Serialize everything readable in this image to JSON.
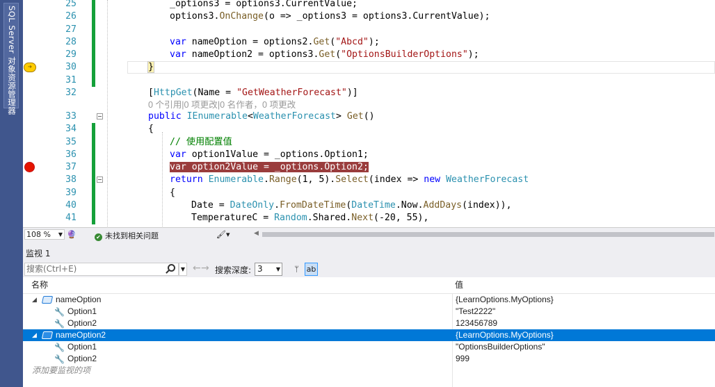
{
  "sidebar": {
    "tab_label": "SQL Server 对象资源管理器"
  },
  "editor": {
    "lines": [
      {
        "num": "25",
        "tokens": [
          [
            "_options3 = options3.",
            "p"
          ],
          [
            "CurrentValue",
            "p"
          ],
          [
            ";",
            "p"
          ]
        ]
      },
      {
        "num": "26",
        "tokens": [
          [
            "options3.",
            "p"
          ],
          [
            "OnChange",
            "mt"
          ],
          [
            "(o => _options3 = options3.CurrentValue);",
            "p"
          ]
        ]
      },
      {
        "num": "27",
        "tokens": []
      },
      {
        "num": "28",
        "tokens": [
          [
            "var",
            "kw"
          ],
          [
            " nameOption = options2.",
            "p"
          ],
          [
            "Get",
            "mt"
          ],
          [
            "(",
            "p"
          ],
          [
            "\"Abcd\"",
            "st"
          ],
          [
            ");",
            "p"
          ]
        ]
      },
      {
        "num": "29",
        "tokens": [
          [
            "var",
            "kw"
          ],
          [
            " nameOption2 = options3.",
            "p"
          ],
          [
            "Get",
            "mt"
          ],
          [
            "(",
            "p"
          ],
          [
            "\"OptionsBuilderOptions\"",
            "st"
          ],
          [
            ");",
            "p"
          ]
        ]
      },
      {
        "num": "30",
        "tokens": []
      },
      {
        "num": "31",
        "tokens": []
      },
      {
        "num": "32",
        "tokens": [
          [
            "[",
            "p"
          ],
          [
            "HttpGet",
            "ty"
          ],
          [
            "(Name = ",
            "p"
          ],
          [
            "\"GetWeatherForecast\"",
            "st"
          ],
          [
            ")]",
            "p"
          ]
        ]
      },
      {
        "num": "",
        "tokens": []
      },
      {
        "num": "33",
        "tokens": [
          [
            "public",
            "kw"
          ],
          [
            " ",
            "p"
          ],
          [
            "IEnumerable",
            "ty"
          ],
          [
            "<",
            "p"
          ],
          [
            "WeatherForecast",
            "ty"
          ],
          [
            "> ",
            "p"
          ],
          [
            "Get",
            "mt"
          ],
          [
            "()",
            "p"
          ]
        ]
      },
      {
        "num": "34",
        "tokens": [
          [
            "{",
            "p"
          ]
        ]
      },
      {
        "num": "35",
        "tokens": [
          [
            "// 使用配置值",
            "cm"
          ]
        ]
      },
      {
        "num": "36",
        "tokens": [
          [
            "var",
            "kw"
          ],
          [
            " option1Value = _options.Option1;",
            "p"
          ]
        ]
      },
      {
        "num": "37",
        "tokens": [
          [
            "var option2Value = _options.Option2;",
            "p"
          ]
        ]
      },
      {
        "num": "38",
        "tokens": [
          [
            "return",
            "kw"
          ],
          [
            " ",
            "p"
          ],
          [
            "Enumerable",
            "ty"
          ],
          [
            ".",
            "p"
          ],
          [
            "Range",
            "mt"
          ],
          [
            "(1, 5).",
            "p"
          ],
          [
            "Select",
            "mt"
          ],
          [
            "(index => ",
            "p"
          ],
          [
            "new",
            "kw"
          ],
          [
            " ",
            "p"
          ],
          [
            "WeatherForecast",
            "ty"
          ]
        ]
      },
      {
        "num": "39",
        "tokens": [
          [
            "{",
            "p"
          ]
        ]
      },
      {
        "num": "40",
        "tokens": [
          [
            "Date = ",
            "p"
          ],
          [
            "DateOnly",
            "ty"
          ],
          [
            ".",
            "p"
          ],
          [
            "FromDateTime",
            "mt"
          ],
          [
            "(",
            "p"
          ],
          [
            "DateTime",
            "ty"
          ],
          [
            ".Now.",
            "p"
          ],
          [
            "AddDays",
            "mt"
          ],
          [
            "(index)),",
            "p"
          ]
        ]
      },
      {
        "num": "41",
        "tokens": [
          [
            "TemperatureC = ",
            "p"
          ],
          [
            "Random",
            "ty"
          ],
          [
            ".Shared.",
            "p"
          ],
          [
            "Next",
            "mt"
          ],
          [
            "(-20, 55),",
            "p"
          ]
        ]
      }
    ],
    "line30_brace": "}",
    "codelens": "0 个引用|0 项更改|0 名作者，0 项更改"
  },
  "status": {
    "zoom": "108 %",
    "issues": "未找到相关问题"
  },
  "watch": {
    "title": "监视 1",
    "search_placeholder": "搜索(Ctrl+E)",
    "depth_label": "搜索深度:",
    "depth_value": "3",
    "col_name": "名称",
    "col_value": "值",
    "rows": [
      {
        "name": "nameOption",
        "value": "{LearnOptions.MyOptions}"
      },
      {
        "name": "Option1",
        "value": "\"Test2222\""
      },
      {
        "name": "Option2",
        "value": "123456789"
      },
      {
        "name": "nameOption2",
        "value": "{LearnOptions.MyOptions}"
      },
      {
        "name": "Option1",
        "value": "\"OptionsBuilderOptions\""
      },
      {
        "name": "Option2",
        "value": "999"
      }
    ],
    "add_watch_placeholder": "添加要监视的项"
  }
}
